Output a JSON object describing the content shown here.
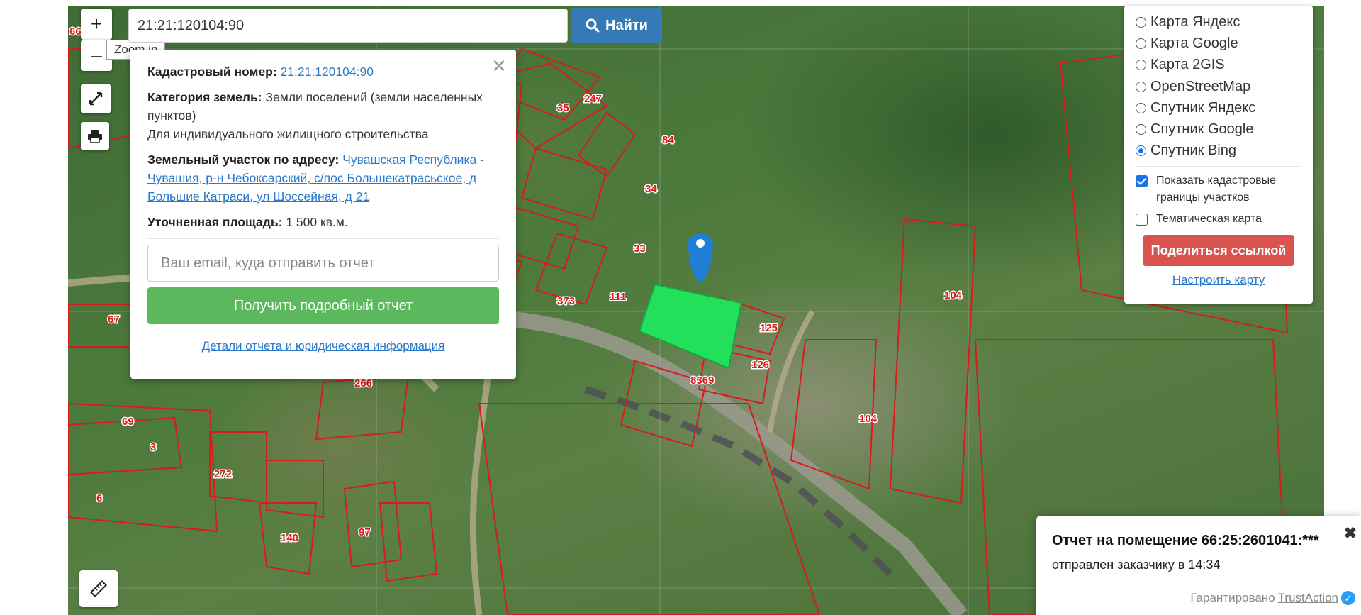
{
  "search": {
    "value": "21:21:120104:90",
    "button_label": "Найти"
  },
  "controls": {
    "zoom_in": "+",
    "zoom_out": "–",
    "zoom_in_tooltip": "Zoom in"
  },
  "popup": {
    "cadastral_label": "Кадастровый номер:",
    "cadastral_value": "21:21:120104:90",
    "category_label": "Категория земель:",
    "category_value": "Земли поселений (земли населенных пунктов)",
    "usage": "Для индивидуального жилищного строительства",
    "address_label": "Земельный участок по адресу:",
    "address_value": "Чувашская Республика - Чувашия, р-н Чебоксарский, с/пос Большекатрасьское, д Большие Катраси, ул Шоссейная, д 21",
    "area_label": "Уточненная площадь:",
    "area_value": "1 500 кв.м.",
    "email_placeholder": "Ваш email, куда отправить отчет",
    "report_button": "Получить подробный отчет",
    "details_link": "Детали отчета и юридическая информация"
  },
  "layers": {
    "options": [
      {
        "label": "Карта Яндекс",
        "selected": false
      },
      {
        "label": "Карта Google",
        "selected": false
      },
      {
        "label": "Карта 2GIS",
        "selected": false
      },
      {
        "label": "OpenStreetMap",
        "selected": false
      },
      {
        "label": "Спутник Яндекс",
        "selected": false
      },
      {
        "label": "Спутник Google",
        "selected": false
      },
      {
        "label": "Спутник Bing",
        "selected": true
      }
    ],
    "show_boundaries": "Показать кадастровые границы участков",
    "show_boundaries_checked": true,
    "thematic": "Тематическая карта",
    "thematic_checked": false,
    "share_button": "Поделиться ссылкой",
    "configure_link": "Настроить карту"
  },
  "map": {
    "plot_labels": [
      "35",
      "247",
      "84",
      "34",
      "33",
      "111",
      "373",
      "125",
      "126",
      "8369",
      "104",
      "104",
      "67",
      "266",
      "69",
      "3",
      "272",
      "6",
      "140",
      "97",
      "66"
    ],
    "boundary_color": "#d81b1b",
    "selected_plot_color": "#22e05a",
    "marker_color": "#1f7fd6"
  },
  "notification": {
    "title": "Отчет на помещение 66:25:2601041:***",
    "subtitle": "отправлен заказчику в 14:34",
    "guarantee_prefix": "Гарантировано",
    "guarantee_link": "TrustAction"
  }
}
